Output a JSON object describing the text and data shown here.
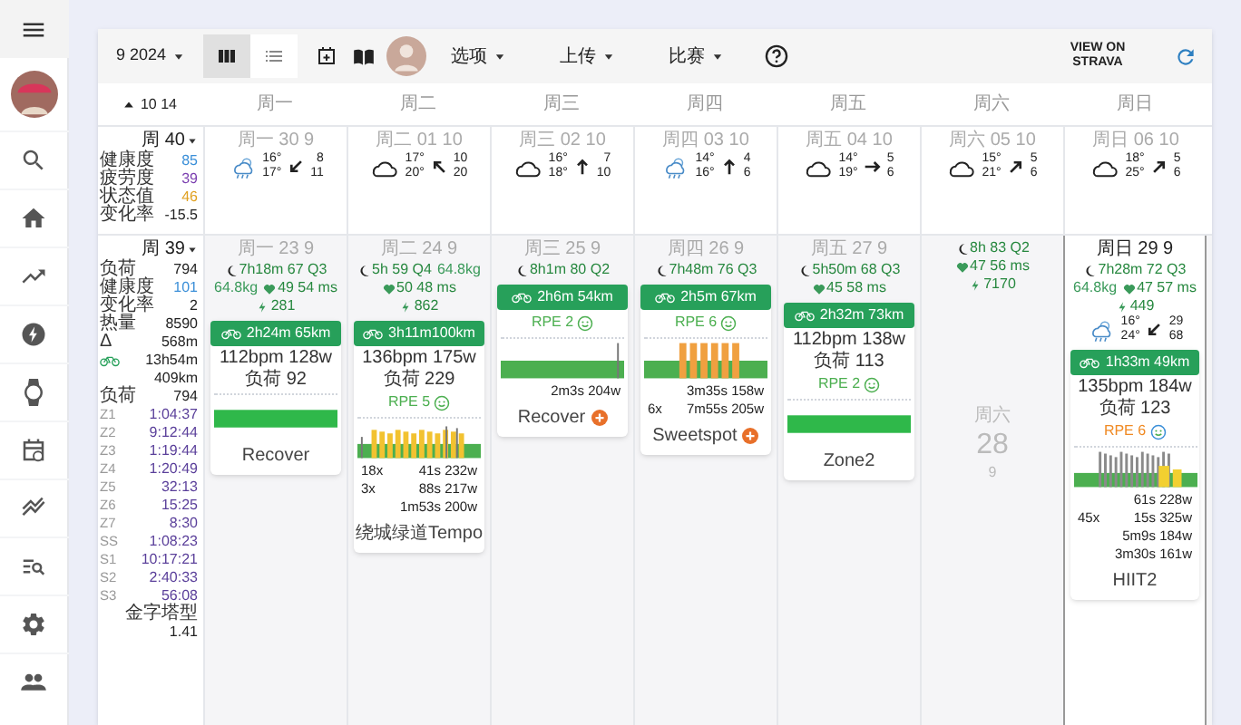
{
  "toolbar": {
    "month": "9 2024",
    "views": [
      {
        "kind": "grid",
        "selected": true
      },
      {
        "kind": "list",
        "selected": false
      }
    ],
    "menus": [
      "选项",
      "上传",
      "比赛"
    ],
    "strava": "VIEW ON STRAVA"
  },
  "header": {
    "range": "10 14",
    "weekdays": [
      "周一",
      "周二",
      "周三",
      "周四",
      "周五",
      "周六",
      "周日"
    ]
  },
  "weeks": [
    {
      "label": "周 40",
      "summary": [
        {
          "label": "健康度",
          "value": "85",
          "color": "#3b8fd8"
        },
        {
          "label": "疲劳度",
          "value": "39",
          "color": "#7b3fb0"
        },
        {
          "label": "状态值",
          "value": "46",
          "color": "#e0a020"
        },
        {
          "label": "变化率",
          "value": "-15.5"
        }
      ],
      "days": [
        {
          "date": "周一 30 9",
          "today": false,
          "weather": {
            "kind": "rain",
            "high": "16°",
            "low": "17°",
            "wind": {
              "kind": "sw",
              "speed": "8",
              "gust": "11"
            }
          }
        },
        {
          "date": "周二 01 10",
          "today": false,
          "weather": {
            "kind": "cloud",
            "high": "17°",
            "low": "20°",
            "wind": {
              "kind": "nw",
              "speed": "10",
              "gust": "20"
            }
          }
        },
        {
          "date": "周三 02 10",
          "today": false,
          "weather": {
            "kind": "cloud",
            "high": "16°",
            "low": "18°",
            "wind": {
              "kind": "n",
              "speed": "7",
              "gust": "10"
            }
          }
        },
        {
          "date": "周四 03 10",
          "today": false,
          "weather": {
            "kind": "rain",
            "high": "14°",
            "low": "16°",
            "wind": {
              "kind": "n",
              "speed": "4",
              "gust": "6"
            }
          }
        },
        {
          "date": "周五 04 10",
          "today": false,
          "weather": {
            "kind": "cloud",
            "high": "14°",
            "low": "19°",
            "wind": {
              "kind": "e",
              "speed": "5",
              "gust": "6"
            }
          }
        },
        {
          "date": "周六 05 10",
          "today": false,
          "weather": {
            "kind": "cloud",
            "high": "15°",
            "low": "21°",
            "wind": {
              "kind": "ne",
              "speed": "5",
              "gust": "6"
            }
          }
        },
        {
          "date": "周日 06 10",
          "today": false,
          "weather": {
            "kind": "cloud",
            "high": "18°",
            "low": "25°",
            "wind": {
              "kind": "ne",
              "speed": "5",
              "gust": "6"
            }
          }
        }
      ]
    },
    {
      "label": "周 39",
      "summary": [
        {
          "label": "负荷",
          "value": "794"
        },
        {
          "label": "健康度",
          "value": "101",
          "color": "#3b8fd8"
        },
        {
          "label": "变化率",
          "value": "2"
        },
        {
          "label": "热量",
          "value": "8590"
        },
        {
          "label": "Δ",
          "value": "568m"
        },
        {
          "kind": "ride",
          "value": "13h54m"
        },
        {
          "value": "409km"
        },
        {
          "label": "负荷",
          "value": "794"
        },
        {
          "label": "Z1",
          "value": "1:04:37",
          "color": "#5a3f9a"
        },
        {
          "label": "Z2",
          "value": "9:12:44",
          "color": "#5a3f9a"
        },
        {
          "label": "Z3",
          "value": "1:19:44",
          "color": "#5a3f9a"
        },
        {
          "label": "Z4",
          "value": "1:20:49",
          "color": "#5a3f9a"
        },
        {
          "label": "Z5",
          "value": "32:13",
          "color": "#5a3f9a"
        },
        {
          "label": "Z6",
          "value": "15:25",
          "color": "#5a3f9a"
        },
        {
          "label": "Z7",
          "value": "8:30",
          "color": "#5a3f9a"
        },
        {
          "label": "SS",
          "value": "1:08:23",
          "color": "#5a3f9a"
        },
        {
          "label": "S1",
          "value": "10:17:21",
          "color": "#5a3f9a"
        },
        {
          "label": "S2",
          "value": "2:40:33",
          "color": "#5a3f9a"
        },
        {
          "label": "S3",
          "value": "56:08",
          "color": "#5a3f9a"
        },
        {
          "label": "金字塔型"
        },
        {
          "value": "1.41"
        }
      ],
      "days": [
        {
          "date": "周一 23 9",
          "today": false,
          "wellness": [
            [
              {
                "kind": "sleep",
                "text": "7h18m 67 Q3"
              }
            ],
            [
              {
                "kind": "weight",
                "text": "64.8kg"
              },
              {
                "kind": "hrv",
                "text": "49 54 ms"
              }
            ],
            [
              {
                "kind": "energy",
                "text": "281"
              }
            ]
          ],
          "activity": {
            "duration": "2h24m 65km",
            "stats": [
              "112bpm 128w",
              "负荷 92"
            ],
            "chart": {
              "kind": "flat"
            },
            "name": "Recover",
            "plus": false
          }
        },
        {
          "date": "周二 24 9",
          "today": false,
          "wellness": [
            [
              {
                "kind": "sleep",
                "text": "5h 59 Q4"
              },
              {
                "kind": "weight",
                "text": "64.8kg"
              }
            ],
            [
              {
                "kind": "hrv",
                "text": "50 48 ms"
              }
            ],
            [
              {
                "kind": "energy",
                "text": "862"
              }
            ]
          ],
          "activity": {
            "duration": "3h11m100km",
            "stats": [
              "136bpm 175w",
              "负荷 229"
            ],
            "rpe": {
              "text": "RPE 5",
              "color": "#4caf50"
            },
            "chart": {
              "kind": "tempo"
            },
            "intervals": [
              {
                "reps": "18x",
                "text": "41s 232w"
              },
              {
                "reps": "3x",
                "text": "88s 217w"
              },
              {
                "text": "1m53s 200w"
              }
            ],
            "name": "绕城绿道Tempo",
            "plus": false
          }
        },
        {
          "date": "周三 25 9",
          "today": false,
          "wellness": [
            [
              {
                "kind": "sleep",
                "text": "8h1m 80 Q2"
              }
            ]
          ],
          "activity": {
            "duration": "2h6m 54km",
            "rpe": {
              "text": "RPE 2",
              "color": "#4caf50"
            },
            "chart": {
              "kind": "steady"
            },
            "intervals": [
              {
                "text": "2m3s 204w"
              }
            ],
            "name": "Recover",
            "plus": true
          }
        },
        {
          "date": "周四 26 9",
          "today": false,
          "wellness": [
            [
              {
                "kind": "sleep",
                "text": "7h48m 76 Q3"
              }
            ]
          ],
          "activity": {
            "duration": "2h5m 67km",
            "rpe": {
              "text": "RPE 6",
              "color": "#4caf50"
            },
            "chart": {
              "kind": "sweetspot"
            },
            "intervals": [
              {
                "text": "3m35s 158w"
              },
              {
                "reps": "6x",
                "text": "7m55s 205w"
              }
            ],
            "name": "Sweetspot",
            "plus": true
          }
        },
        {
          "date": "周五 27 9",
          "today": false,
          "wellness": [
            [
              {
                "kind": "sleep",
                "text": "5h50m 68 Q3"
              }
            ],
            [
              {
                "kind": "hrv",
                "text": "45 58 ms"
              }
            ]
          ],
          "activity": {
            "duration": "2h32m 73km",
            "stats": [
              "112bpm 138w",
              "负荷 113"
            ],
            "rpe": {
              "text": "RPE 2",
              "color": "#4caf50"
            },
            "chart": {
              "kind": "flat"
            },
            "name": "Zone2",
            "plus": false
          }
        },
        {
          "today": false,
          "wellness": [
            [
              {
                "kind": "sleep",
                "text": "8h 83 Q2"
              }
            ],
            [
              {
                "kind": "hrv",
                "text": "47 56 ms"
              }
            ],
            [
              {
                "kind": "energy",
                "text": "7170"
              }
            ]
          ],
          "empty": {
            "weekday": "周六",
            "day": "28",
            "month": "9"
          }
        },
        {
          "date": "周日 29 9",
          "today": true,
          "wellness": [
            [
              {
                "kind": "sleep",
                "text": "7h28m 72 Q3"
              }
            ],
            [
              {
                "kind": "weight",
                "text": "64.8kg"
              },
              {
                "kind": "hrv",
                "text": "47 57 ms"
              }
            ],
            [
              {
                "kind": "energy",
                "text": "449"
              }
            ]
          ],
          "weather": {
            "kind": "rain",
            "high": "16°",
            "low": "24°",
            "wind": {
              "kind": "sw",
              "speed": "29",
              "gust": "68"
            }
          },
          "activity": {
            "duration": "1h33m 49km",
            "stats": [
              "135bpm 184w",
              "负荷 123"
            ],
            "rpe": {
              "text": "RPE 6",
              "color": "#f08a24"
            },
            "chart": {
              "kind": "hiit"
            },
            "intervals": [
              {
                "text": "61s 228w"
              },
              {
                "reps": "45x",
                "text": "15s 325w"
              },
              {
                "text": "5m9s 184w"
              },
              {
                "text": "3m30s 161w"
              }
            ],
            "name": "HIIT2",
            "plus": false
          }
        }
      ]
    }
  ]
}
